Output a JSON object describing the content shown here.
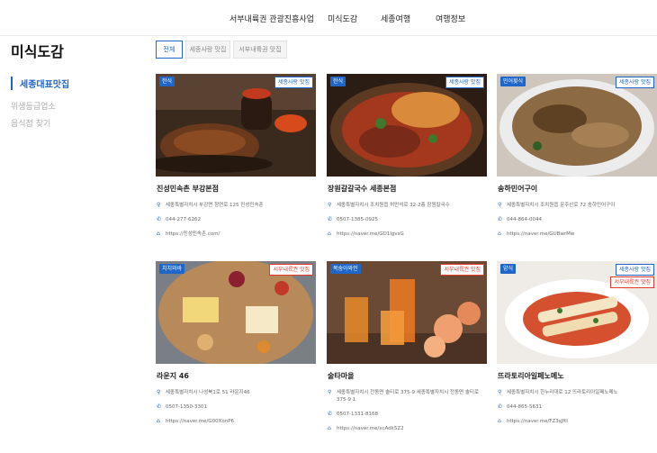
{
  "nav": [
    "서부내륙권 관광진흥사업",
    "미식도감",
    "세종여행",
    "여행정보"
  ],
  "page_title": "미식도감",
  "sidebar": [
    "세종대표맛집",
    "위생등급업소",
    "음식점 찾기"
  ],
  "tabs": [
    "전체",
    "세종사랑 맛집",
    "서부내륙권 맛집"
  ],
  "cards": [
    {
      "category": "한식",
      "tags": [
        "세종사랑 맛집"
      ],
      "name": "진성민속촌 부강본점",
      "address": "세종특별자치시 부강면 청연로 125 진성민속촌",
      "phone": "044-277-6262",
      "url": "https://진성민속촌.com/"
    },
    {
      "category": "한식",
      "tags": [
        "세종사랑 맛집"
      ],
      "name": "장원갈갈국수 세종본점",
      "address": "세종특별자치시 조치원읍 허만석로 32-2층 장원칼국수",
      "phone": "0507-1385-0925",
      "url": "https://naver.me/GD1IgvsG"
    },
    {
      "category": "민어횟식",
      "tags": [
        "세종사랑 맛집"
      ],
      "name": "송하민어구이",
      "address": "세종특별자치시 조치원읍 문주산로 72 송하민어구이",
      "phone": "044-864-0044",
      "url": "https://naver.me/GUBwrMw"
    },
    {
      "category": "치치와바",
      "tags": [
        "서부내륙권 맛집"
      ],
      "name": "라운지 46",
      "address": "세종특별자치시 나성북1로 51 라운지46",
      "phone": "0507-1350-3301",
      "url": "https://naver.me/G00XonP6"
    },
    {
      "category": "복숭아와인",
      "tags": [
        "서부내륙권 맛집"
      ],
      "name": "술타마을",
      "address": "세종특별자치시 전동면 솔티로 375-9 세종특별자치시 전동면 솔티로 375-9 1",
      "phone": "0507-1331-8168",
      "url": "https://naver.me/xcAdk5Z2"
    },
    {
      "category": "양식",
      "tags": [
        "세종사랑 맛집",
        "서부내륙권 맛집"
      ],
      "name": "뜨라토리아일페노메노",
      "address": "세종특별자치시 한누리대로 12 뜨라토리아일페노메노",
      "phone": "044-865-5631",
      "url": "https://naver.me/FZ3sJftI"
    }
  ],
  "icons": {
    "address": "location-pin-icon",
    "phone": "phone-icon",
    "url": "home-icon"
  },
  "colors": {
    "accent": "#1f66c9",
    "tag_red": "#e23b2e"
  }
}
